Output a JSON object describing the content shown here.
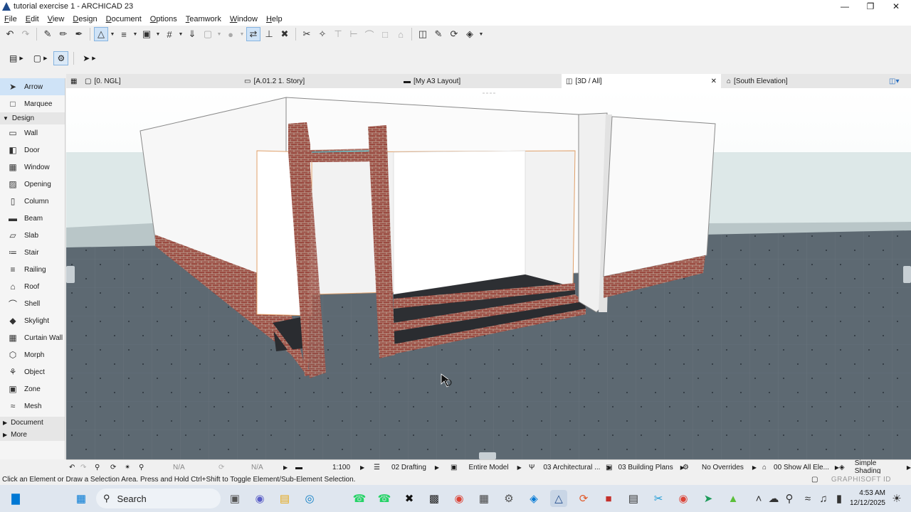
{
  "window": {
    "title": "tutorial exercise 1 - ARCHICAD 23"
  },
  "menu": [
    "File",
    "Edit",
    "View",
    "Design",
    "Document",
    "Options",
    "Teamwork",
    "Window",
    "Help"
  ],
  "toolbox": {
    "arrow": "Arrow",
    "marquee": "Marquee",
    "design_section": "Design",
    "items": [
      "Wall",
      "Door",
      "Window",
      "Opening",
      "Column",
      "Beam",
      "Slab",
      "Stair",
      "Railing",
      "Roof",
      "Shell",
      "Skylight",
      "Curtain Wall",
      "Morph",
      "Object",
      "Zone",
      "Mesh"
    ],
    "document_section": "Document",
    "more_section": "More"
  },
  "tabs": {
    "t1": "[0. NGL]",
    "t2": "[A.01.2 1. Story]",
    "t3": "[My A3 Layout]",
    "t4": "[3D / All]",
    "t5": "[South Elevation]"
  },
  "status": {
    "na1": "N/A",
    "na2": "N/A",
    "scale": "1:100",
    "layer_combo": "02 Drafting",
    "model": "Entire Model",
    "pen_set": "03 Architectural ...",
    "model_view": "03 Building Plans",
    "overrides": "No Overrides",
    "renovation": "00 Show All Ele...",
    "shading": "Simple Shading"
  },
  "hint": "Click an Element or Draw a Selection Area. Press and Hold Ctrl+Shift to Toggle Element/Sub-Element Selection.",
  "brand": "GRAPHISOFT ID",
  "taskbar": {
    "search": "Search",
    "time": "4:53 AM",
    "date": "12/12/2025"
  },
  "colors": {
    "sky": "#ffffff",
    "ground": "#5f6b73",
    "brick": "#9a4a40",
    "accent": "#0078d4"
  }
}
